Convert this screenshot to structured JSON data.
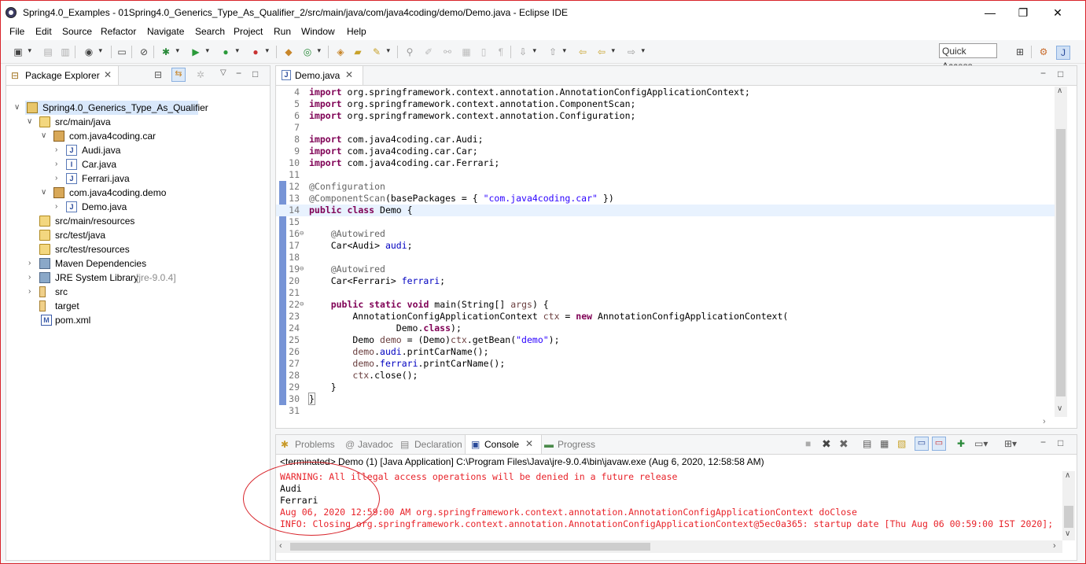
{
  "window": {
    "title": "Spring4.0_Examples - 01Spring4.0_Generics_Type_As_Qualifier_2/src/main/java/com/java4coding/demo/Demo.java - Eclipse IDE",
    "minimize": "—",
    "maximize": "❐",
    "close": "✕"
  },
  "menu": [
    "File",
    "Edit",
    "Source",
    "Refactor",
    "Navigate",
    "Search",
    "Project",
    "Run",
    "Window",
    "Help"
  ],
  "quick_access": "Quick Access",
  "package_explorer": {
    "tab_label": "Package Explorer",
    "tree": [
      {
        "label": "Spring4.0_Generics_Type_As_Qualifier",
        "icon": "project-icon"
      },
      {
        "label": "src/main/java",
        "icon": "source-folder-icon"
      },
      {
        "label": "com.java4coding.car",
        "icon": "package-icon"
      },
      {
        "label": "Audi.java",
        "icon": "java-file-icon"
      },
      {
        "label": "Car.java",
        "icon": "java-interface-icon"
      },
      {
        "label": "Ferrari.java",
        "icon": "java-file-icon"
      },
      {
        "label": "com.java4coding.demo",
        "icon": "package-icon"
      },
      {
        "label": "Demo.java",
        "icon": "java-file-icon"
      },
      {
        "label": "src/main/resources",
        "icon": "source-folder-icon"
      },
      {
        "label": "src/test/java",
        "icon": "source-folder-icon"
      },
      {
        "label": "src/test/resources",
        "icon": "source-folder-icon"
      },
      {
        "label": "Maven Dependencies",
        "icon": "library-icon"
      },
      {
        "label": "JRE System Library",
        "suffix": "[jre-9.0.4]",
        "icon": "library-icon"
      },
      {
        "label": "src",
        "icon": "folder-icon"
      },
      {
        "label": "target",
        "icon": "folder-icon"
      },
      {
        "label": "pom.xml",
        "icon": "xml-file-icon"
      }
    ]
  },
  "editor": {
    "tab_label": "Demo.java",
    "line_numbers": [
      "4",
      "5",
      "6",
      "7",
      "8",
      "9",
      "10",
      "11",
      "12",
      "13",
      "14",
      "15",
      "16",
      "17",
      "18",
      "19",
      "20",
      "21",
      "22",
      "23",
      "24",
      "25",
      "26",
      "27",
      "28",
      "29",
      "30",
      "31"
    ]
  },
  "console": {
    "tabs": [
      "Problems",
      "Javadoc",
      "Declaration",
      "Console",
      "Progress"
    ],
    "status": "<terminated> Demo (1) [Java Application] C:\\Program Files\\Java\\jre-9.0.4\\bin\\javaw.exe (Aug 6, 2020, 12:58:58 AM)",
    "output": [
      {
        "text": "WARNING: All illegal access operations will be denied in a future release",
        "type": "error"
      },
      {
        "text": "Audi",
        "type": "normal"
      },
      {
        "text": "Ferrari",
        "type": "normal"
      },
      {
        "text": "Aug 06, 2020 12:59:00 AM org.springframework.context.annotation.AnnotationConfigApplicationContext doClose",
        "type": "error"
      },
      {
        "text": "INFO: Closing org.springframework.context.annotation.AnnotationConfigApplicationContext@5ec0a365: startup date [Thu Aug 06 00:59:00 IST 2020];",
        "type": "error"
      }
    ]
  },
  "colors": {
    "keyword": "#7f0055",
    "annotation": "#646464",
    "string": "#2a00ff",
    "field": "#0000c0",
    "console_error": "#e8232a",
    "highlight_border": "#d8232a"
  }
}
